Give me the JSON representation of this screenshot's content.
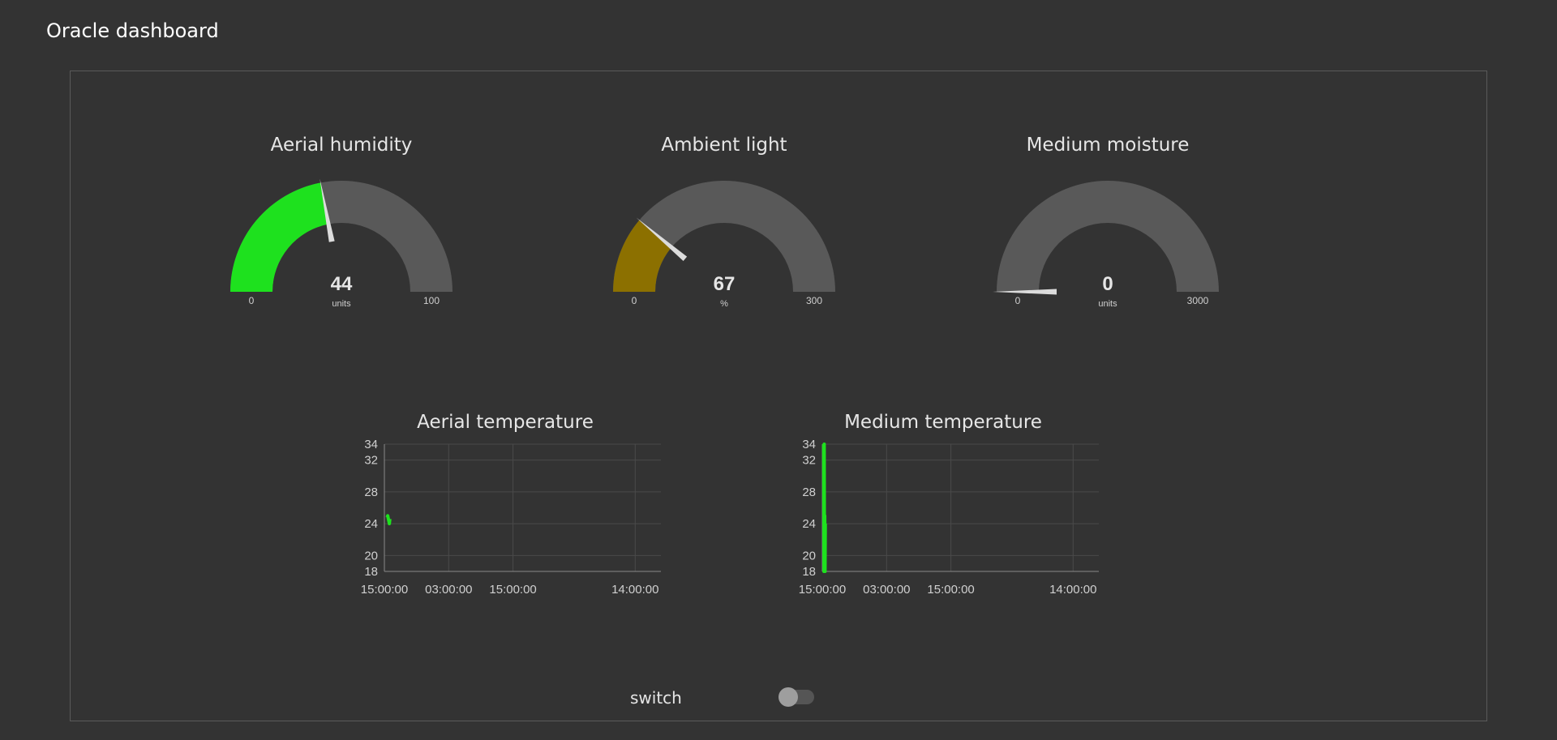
{
  "dashboard": {
    "title": "Oracle dashboard"
  },
  "gauges": [
    {
      "title": "Aerial humidity",
      "value": 44,
      "display": "44",
      "unit": "units",
      "min": 0,
      "max": 100,
      "min_label": "0",
      "max_label": "100",
      "color": "#1ee11e"
    },
    {
      "title": "Ambient light",
      "value": 67,
      "display": "67",
      "unit": "%",
      "min": 0,
      "max": 300,
      "min_label": "0",
      "max_label": "300",
      "color": "#8c7000"
    },
    {
      "title": "Medium moisture",
      "value": 0,
      "display": "0",
      "unit": "units",
      "min": 0,
      "max": 3000,
      "min_label": "0",
      "max_label": "3000",
      "color": "#1ee11e"
    }
  ],
  "gauge_track_color": "#595959",
  "charts": [
    {
      "title": "Aerial temperature",
      "chart_data": {
        "type": "line",
        "x_ticks": [
          "15:00:00",
          "03:00:00",
          "15:00:00",
          "14:00:00"
        ],
        "y_ticks": [
          18,
          20,
          24,
          28,
          32,
          34
        ],
        "ylim": [
          18,
          34
        ],
        "series": [
          {
            "color": "#1ee11e",
            "x": [
              0.01,
              0.012,
              0.015,
              0.018,
              0.02
            ],
            "y": [
              24.8,
              25.0,
              24.5,
              24.0,
              24.6
            ]
          }
        ]
      }
    },
    {
      "title": "Medium temperature",
      "chart_data": {
        "type": "line",
        "x_ticks": [
          "15:00:00",
          "03:00:00",
          "15:00:00",
          "14:00:00"
        ],
        "y_ticks": [
          18,
          20,
          24,
          28,
          32,
          34
        ],
        "ylim": [
          18,
          34
        ],
        "series": [
          {
            "color": "#1ee11e",
            "x": [
              0.005,
              0.006,
              0.007,
              0.008,
              0.009,
              0.01,
              0.011
            ],
            "y": [
              34,
              18,
              34,
              18,
              25,
              18,
              24
            ]
          }
        ]
      }
    }
  ],
  "switch": {
    "label": "switch",
    "state": "off"
  }
}
